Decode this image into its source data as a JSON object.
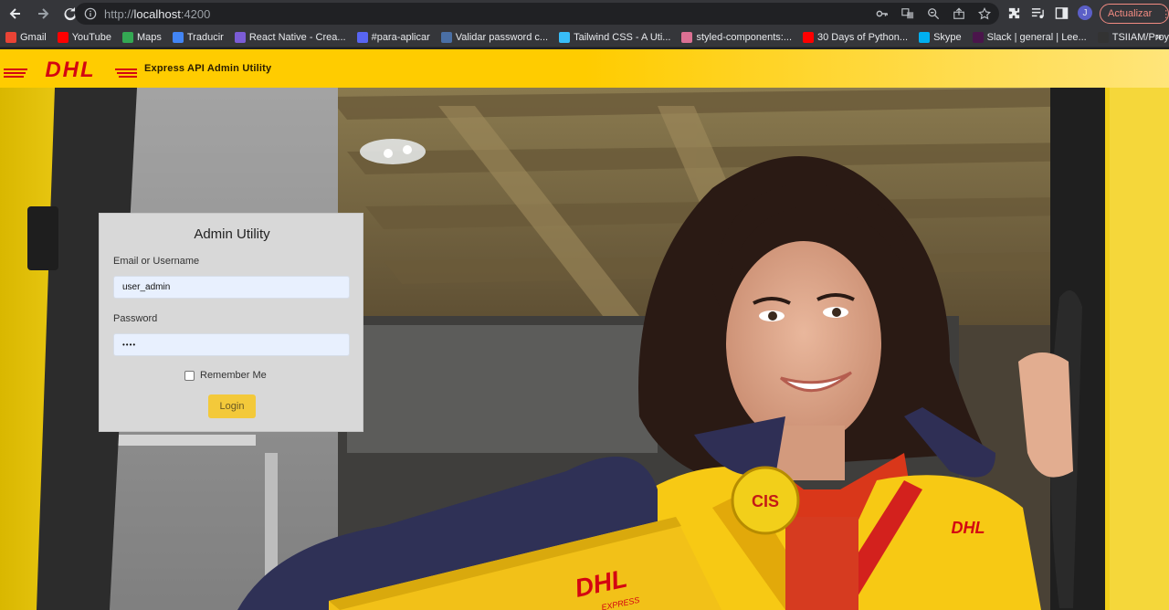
{
  "browser": {
    "url_scheme": "http://",
    "url_host": "localhost",
    "url_port": ":4200",
    "update_label": "Actualizar",
    "profile_initial": "J"
  },
  "bookmarks": [
    {
      "label": "Gmail",
      "color": "#ea4335"
    },
    {
      "label": "YouTube",
      "color": "#ff0000"
    },
    {
      "label": "Maps",
      "color": "#34a853"
    },
    {
      "label": "Traducir",
      "color": "#4285f4"
    },
    {
      "label": "React Native - Crea...",
      "color": "#7b5cd6"
    },
    {
      "label": "#para-aplicar",
      "color": "#5865f2"
    },
    {
      "label": "Validar password c...",
      "color": "#4a6fa5"
    },
    {
      "label": "Tailwind CSS - A Uti...",
      "color": "#38bdf8"
    },
    {
      "label": "styled-components:...",
      "color": "#db7093"
    },
    {
      "label": "30 Days of Python...",
      "color": "#ff0000"
    },
    {
      "label": "Skype",
      "color": "#00aff0"
    },
    {
      "label": "Slack | general | Lee...",
      "color": "#4a154b"
    },
    {
      "label": "TSIIAM/ProyectoPH...",
      "color": "#333333"
    }
  ],
  "header": {
    "logo_text": "DHL",
    "title": "Express API Admin Utility"
  },
  "login": {
    "title": "Admin Utility",
    "username_label": "Email or Username",
    "username_value": "user_admin",
    "password_label": "Password",
    "password_value": "••••",
    "remember_label": "Remember Me",
    "login_label": "Login"
  },
  "colors": {
    "dhl_yellow": "#ffcc00",
    "dhl_red": "#d40511",
    "login_button": "#f3c93a"
  }
}
